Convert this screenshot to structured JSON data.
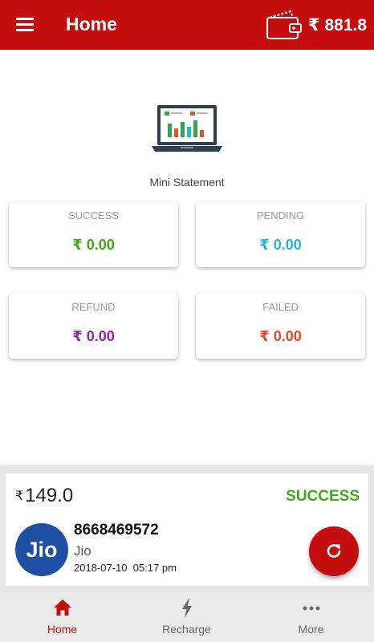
{
  "header": {
    "title": "Home",
    "currency": "₹",
    "balance": "881.8"
  },
  "mini_statement": {
    "label": "Mini Statement"
  },
  "summary": [
    {
      "label": "SUCCESS",
      "currency": "₹",
      "value": "0.00",
      "color": "#3fab14"
    },
    {
      "label": "PENDING",
      "currency": "₹",
      "value": "0.00",
      "color": "#2ab5d8"
    },
    {
      "label": "REFUND",
      "currency": "₹",
      "value": "0.00",
      "color": "#8e24aa"
    },
    {
      "label": "FAILED",
      "currency": "₹",
      "value": "0.00",
      "color": "#e04a2a"
    }
  ],
  "transaction": {
    "currency": "₹",
    "amount": "149.0",
    "status": "SUCCESS",
    "logo_text": "Jio",
    "mobile": "8668469572",
    "operator": "Jio",
    "date": "2018-07-10",
    "time": "05:17 pm"
  },
  "nav": [
    {
      "label": "Home",
      "icon": "home-icon",
      "active": true
    },
    {
      "label": "Recharge",
      "icon": "lightning-icon",
      "active": false
    },
    {
      "label": "More",
      "icon": "more-dots-icon",
      "active": false
    }
  ],
  "colors": {
    "brand": "#c40e0e",
    "success": "#3fab14",
    "jio_blue": "#1e4fa3"
  }
}
